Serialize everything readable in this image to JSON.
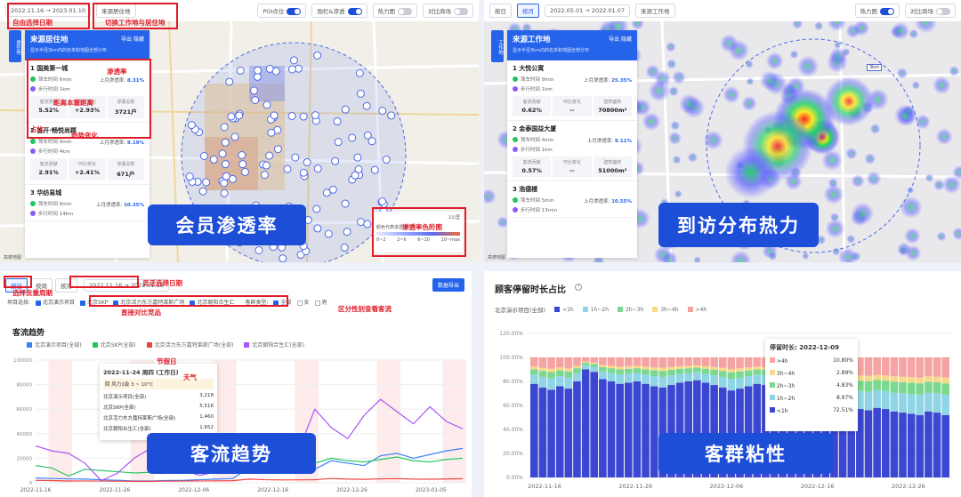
{
  "q1": {
    "date_start": "2022.11.16",
    "date_end": "2023.01.10",
    "source_title": "来源居住地",
    "toggles": [
      {
        "label": "POI点位",
        "on": true
      },
      {
        "label": "围栏&渗透",
        "on": true
      },
      {
        "label": "热力图",
        "on": false
      },
      {
        "label": "对比商场",
        "on": false
      }
    ],
    "side_tab": "居住地",
    "panel": {
      "title": "来源居住地",
      "subtitle": "显示半径3km内的名单和地图全部分布",
      "act1": "导出",
      "act2": "隐藏",
      "items": [
        {
          "name": "1 国美第一城",
          "drive": "驾车时间  6min",
          "walk": "步行时间  1km",
          "pen_label": "上月渗透率:",
          "pen": "8.31%",
          "stats": [
            {
              "l": "客流贡献",
              "v": "5.52%"
            },
            {
              "l": "环比变化",
              "v": "+2.93%"
            },
            {
              "l": "渗漏总数",
              "v": "3721户"
            }
          ]
        },
        {
          "name": "2 首开·畅悦尚郡",
          "drive": "驾车时间  9min",
          "walk": "步行时间  4km",
          "pen_label": "上月渗透率:",
          "pen": "9.19%",
          "stats": [
            {
              "l": "客流贡献",
              "v": "2.91%"
            },
            {
              "l": "环比变化",
              "v": "+2.41%"
            },
            {
              "l": "渗漏总数",
              "v": "671户"
            }
          ]
        },
        {
          "name": "3 华纺易城",
          "drive": "驾车时间  8min",
          "walk": "步行时间  14km",
          "pen_label": "上月渗透率:",
          "pen": "10.35%"
        }
      ]
    },
    "legend": {
      "title": "颜色代表渗透率(%)",
      "scale": "1公里",
      "bins": [
        "0~2",
        "2~6",
        "6~10",
        "10~max"
      ]
    },
    "anno": {
      "date": "自由选择日期",
      "switch": "切换工作地与居住地",
      "pen": "渗透率",
      "dist": "距离本塞距离",
      "share": "占比",
      "trend": "趋势变化",
      "color": "渗透率色阶图"
    },
    "label": "会员渗透率",
    "watermark": "高德地图"
  },
  "q2": {
    "tabs": [
      "按日",
      "按月"
    ],
    "date_start": "2022.05.01",
    "date_end": "2022.01.07",
    "source_title": "来源工作地",
    "toggles": [
      {
        "label": "热力图",
        "on": true
      },
      {
        "label": "对比商场",
        "on": false
      }
    ],
    "side_tab": "工作地",
    "panel": {
      "title": "来源工作地",
      "subtitle": "显示半径3km内的名单和地图全部分布",
      "act1": "导出",
      "act2": "隐藏",
      "items": [
        {
          "name": "1 大悦公寓",
          "drive": "驾车时间  9min",
          "walk": "步行时间  1km",
          "pen_label": "上月渗透率:",
          "pen": "25.35%",
          "stats": [
            {
              "l": "客流贡献",
              "v": "0.62%"
            },
            {
              "l": "环比变化",
              "v": "--"
            },
            {
              "l": "建筑面积",
              "v": "70800m²"
            }
          ]
        },
        {
          "name": "2 金泰国益大厦",
          "drive": "驾车时间  4min",
          "walk": "步行时间  1km",
          "pen_label": "上月渗透率:",
          "pen": "9.11%",
          "stats": [
            {
              "l": "客流贡献",
              "v": "0.57%"
            },
            {
              "l": "环比变化",
              "v": "--"
            },
            {
              "l": "建筑面积",
              "v": "51000m²"
            }
          ]
        },
        {
          "name": "3 浩德楼",
          "drive": "驾车时间  5min",
          "walk": "步行时间  13min",
          "pen_label": "上月渗透率:",
          "pen": "10.55%"
        }
      ]
    },
    "scale": "3km",
    "label": "到访分布热力",
    "watermark": "高德地图"
  },
  "q3": {
    "tabs": [
      "按日",
      "按周",
      "按月"
    ],
    "date_start": "2022.11.16",
    "date_end": "2023.01.10",
    "export": "数据导出",
    "filter_label": "项目选择:",
    "projects": [
      "北京演示项目",
      "北京SKP",
      "北京活力东方嘉特莱斯广场",
      "北京朝阳合生汇"
    ],
    "gender_label": "客群类型:",
    "genders": [
      "全部",
      "女",
      "男"
    ],
    "anno": {
      "date": "灵活选择日期",
      "week": "选择去重周期",
      "compare": "直接对比竞品",
      "gender": "区分性别查看客流",
      "holiday": "节假日",
      "weather": "天气"
    },
    "title": "客流趋势",
    "tooltip": {
      "head": "2022-11-24 周四 (工作日)",
      "weather": "阴   风力1级   3 ~ 10°C",
      "rows": [
        {
          "name": "北京演示项目(全部)",
          "v": "3,218"
        },
        {
          "name": "北京SKP(全部)",
          "v": "5,516"
        },
        {
          "name": "北京活力东方嘉特莱斯广场(全部)",
          "v": "1,460"
        },
        {
          "name": "北京朝阳合生汇(全部)",
          "v": "1,652"
        }
      ]
    },
    "label": "客流趋势"
  },
  "q4": {
    "title": "顾客停留时长占比",
    "project": "北京演示项目(全部)",
    "legend": [
      "<1h",
      "1h~2h",
      "2h~3h",
      "3h~4h",
      ">4h"
    ],
    "colors": [
      "#3b46d1",
      "#8fd5e6",
      "#7bd88f",
      "#f7d98b",
      "#f6a3a3"
    ],
    "tooltip": {
      "head": "停留时长:",
      "date": "2022-12-09",
      "rows": [
        {
          "name": ">4h",
          "v": "10.80%"
        },
        {
          "name": "3h~4h",
          "v": "2.89%"
        },
        {
          "name": "2h~3h",
          "v": "4.83%"
        },
        {
          "name": "1h~2h",
          "v": "8.97%"
        },
        {
          "name": "<1h",
          "v": "72.51%"
        }
      ]
    },
    "label": "客群粘性"
  },
  "chart_data": [
    {
      "type": "line",
      "title": "客流趋势",
      "x_ticks": [
        "2022-11-16",
        "2022-11-26",
        "2022-12-06",
        "2022-12-16",
        "2022-12-26",
        "2023-01-05"
      ],
      "y_ticks": [
        "0",
        "20000",
        "40000",
        "60000",
        "80000",
        "100000"
      ],
      "ylim": [
        0,
        100000
      ],
      "series": [
        {
          "name": "北京演示项目(全部)",
          "color": "#3b82f6",
          "values": [
            4000,
            3500,
            3218,
            3000,
            2500,
            2000,
            1500,
            1500,
            1800,
            2000,
            2500,
            3000,
            3500,
            12000,
            9000,
            8000,
            9000,
            11000,
            18000,
            16000,
            14000,
            22000,
            24000,
            20000,
            23000,
            26000,
            28000
          ]
        },
        {
          "name": "北京SKP(全部)",
          "color": "#22c55e",
          "values": [
            14000,
            12000,
            5516,
            11000,
            10000,
            9000,
            8000,
            8500,
            9000,
            9500,
            10000,
            11000,
            12000,
            18000,
            15000,
            14000,
            15000,
            16000,
            20000,
            18000,
            17000,
            19000,
            21000,
            18000,
            17000,
            19000,
            20000
          ]
        },
        {
          "name": "北京活力东方嘉特莱斯广场(全部)",
          "color": "#ef4444",
          "values": [
            2000,
            1800,
            1460,
            1500,
            1400,
            1300,
            1200,
            1200,
            1300,
            1400,
            1500,
            1600,
            1700,
            3000,
            2500,
            2300,
            2400,
            2500,
            3500,
            3000,
            2800,
            3200,
            3400,
            3000,
            2900,
            3100,
            3300
          ]
        },
        {
          "name": "北京朝阳合生汇(全部)",
          "color": "#a855f7",
          "values": [
            30000,
            26000,
            24000,
            16000,
            1652,
            8000,
            20000,
            28000,
            18000,
            10000,
            6000,
            9000,
            12000,
            40000,
            28000,
            22000,
            26000,
            60000,
            45000,
            36000,
            55000,
            68000,
            58000,
            48000,
            62000,
            50000,
            44000
          ]
        }
      ]
    },
    {
      "type": "bar",
      "title": "顾客停留时长占比",
      "stacked": true,
      "x_ticks": [
        "2022-11-16",
        "2022-11-26",
        "2022-12-06",
        "2022-12-16",
        "2022-12-26"
      ],
      "y_ticks": [
        "0.00%",
        "20.00%",
        "40.00%",
        "60.00%",
        "80.00%",
        "100.00%",
        "120.00%"
      ],
      "ylim": [
        0,
        120
      ],
      "series_names": [
        "<1h",
        "1h~2h",
        "2h~3h",
        "3h~4h",
        ">4h"
      ],
      "lt1h": [
        78,
        75,
        73,
        76,
        74,
        80,
        90,
        88,
        82,
        80,
        78,
        79,
        80,
        78,
        76,
        75,
        77,
        79,
        80,
        81,
        79,
        77,
        75,
        72.51,
        74,
        76,
        78,
        77,
        75,
        74,
        73,
        60,
        62,
        61,
        59,
        58,
        56,
        60,
        57,
        56,
        58,
        57,
        55,
        54,
        53,
        52,
        55,
        54,
        52
      ],
      "other": [
        8.97,
        4.83,
        2.89,
        10.8
      ]
    }
  ]
}
